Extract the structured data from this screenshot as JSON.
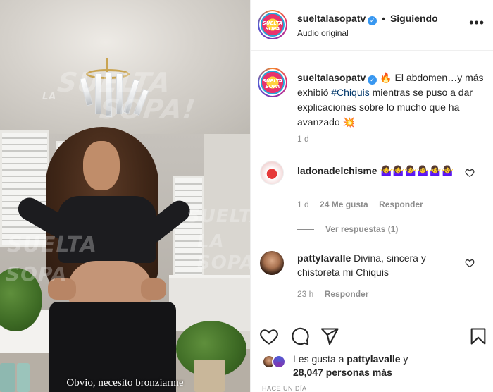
{
  "post": {
    "author": "sueltalasopatv",
    "avatar_text_line1": "SUELTA",
    "avatar_text_line2": "SOPA",
    "follow_status": "Siguiendo",
    "audio_label": "Audio original",
    "more_label": "•••"
  },
  "media": {
    "watermark_line1": "SUELTA",
    "watermark_line2": "SOPA!",
    "watermark_small": "LA",
    "watermark_mid1": "SUELTA",
    "watermark_mid2": "LA SOPA",
    "watermark_left1": "SUELTA",
    "watermark_left2": "SOPA",
    "video_caption": "Obvio, necesito bronziarme"
  },
  "caption": {
    "username": "sueltalasopatv",
    "text_before": " 🔥 El abdomen…y más exhibió ",
    "hashtag": "#Chiquis",
    "text_after": " mientras se puso a dar explicaciones sobre lo mucho que ha avanzado 💥",
    "time": "1 d"
  },
  "comments": [
    {
      "username": "ladonadelchisme",
      "text": "🤷‍♀️🤷‍♀️🤷‍♀️🤷‍♀️🤷‍♀️🤷‍♀️",
      "time": "1 d",
      "likes": "24 Me gusta",
      "reply": "Responder",
      "view_replies": "Ver respuestas (1)"
    },
    {
      "username": "pattylavalle",
      "text": "Divina, sincera y chistoreta mi Chiquis",
      "time": "23 h",
      "reply": "Responder"
    }
  ],
  "likes": {
    "prefix": "Les gusta a ",
    "user": "pattylavalle",
    "joiner": " y",
    "count": "28,047",
    "suffix": " personas más"
  },
  "timestamp": "HACE UN DÍA",
  "colors": {
    "verified": "#3897f0",
    "hashtag": "#00376b",
    "meta_gray": "#8e8e8e",
    "text": "#262626"
  }
}
